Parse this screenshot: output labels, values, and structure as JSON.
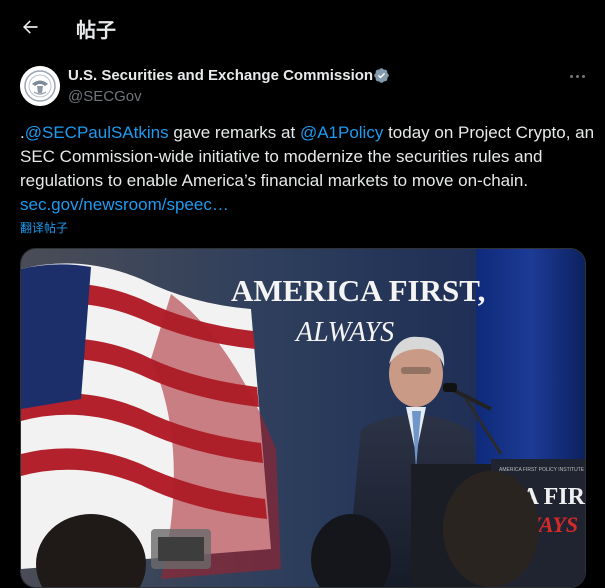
{
  "header": {
    "title": "帖子"
  },
  "author": {
    "name": "U.S. Securities and Exchange Commission",
    "handle": "@SECGov"
  },
  "tweet": {
    "prefix": ".",
    "mention1": "@SECPaulSAtkins",
    "text1": " gave remarks at ",
    "mention2": "@A1Policy",
    "text2": " today on Project Crypto, an SEC Commission-wide initiative to modernize the securities rules and regulations to enable America’s financial markets to move on-chain.",
    "link": "sec.gov/newsroom/speec…",
    "translate": "翻译帖子"
  },
  "media": {
    "backdrop_line1": "AMERICA FIRST,",
    "backdrop_line2": "ALWAYS",
    "podium_small": "AMERICA FIRST POLICY INSTITUTE",
    "podium_line1": "ICA FIR",
    "podium_line2": "WAYS"
  },
  "colors": {
    "background": "#000000",
    "text": "#e7e9ea",
    "muted": "#71767b",
    "link": "#1d9bf0",
    "verified": "#829aab"
  }
}
